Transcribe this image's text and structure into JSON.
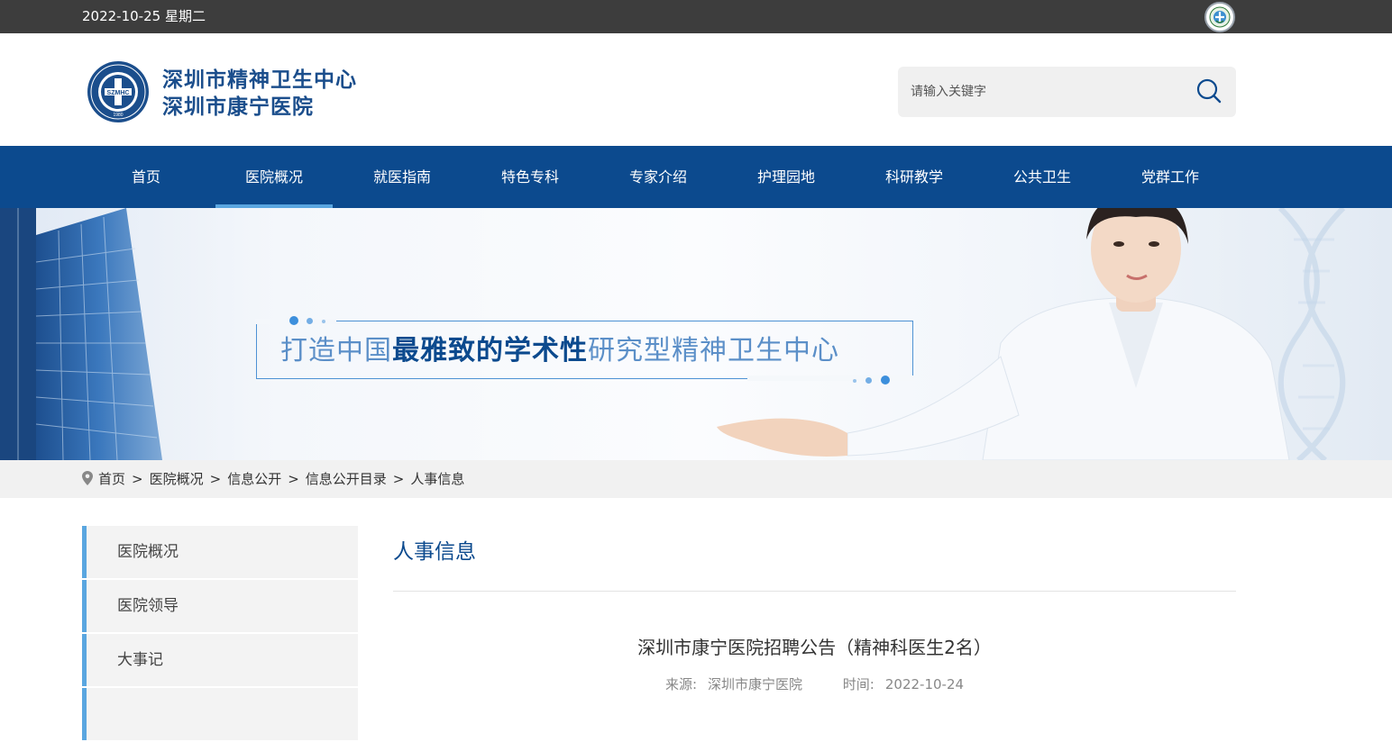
{
  "topbar": {
    "date": "2022-10-25 星期二",
    "badge_icon": "national-health-emblem-icon"
  },
  "header": {
    "logo_line1": "深圳市精神卫生中心",
    "logo_line2": "深圳市康宁医院",
    "seal_text": "SZMHC",
    "seal_year": "1980",
    "search_placeholder": "请输入关键字",
    "brand_color": "#1b4e8c"
  },
  "nav": {
    "color": "#0c4a8e",
    "items": [
      "首页",
      "医院概况",
      "就医指南",
      "特色专科",
      "专家介绍",
      "护理园地",
      "科研教学",
      "公共卫生",
      "党群工作"
    ],
    "active": "医院概况"
  },
  "banner": {
    "slogan_prefix": "打造中国",
    "slogan_bold": "最雅致的学术性",
    "slogan_suffix": "研究型精神卫生中心"
  },
  "breadcrumb": {
    "items": [
      "首页",
      "医院概况",
      "信息公开",
      "信息公开目录",
      "人事信息"
    ],
    "separator": ">"
  },
  "sidebar": {
    "items": [
      "医院概况",
      "医院领导",
      "大事记"
    ]
  },
  "content": {
    "section_title": "人事信息",
    "article_title": "深圳市康宁医院招聘公告（精神科医生2名）",
    "source_label": "来源:",
    "source_value": "深圳市康宁医院",
    "time_label": "时间:",
    "time_value": "2022-10-24"
  }
}
